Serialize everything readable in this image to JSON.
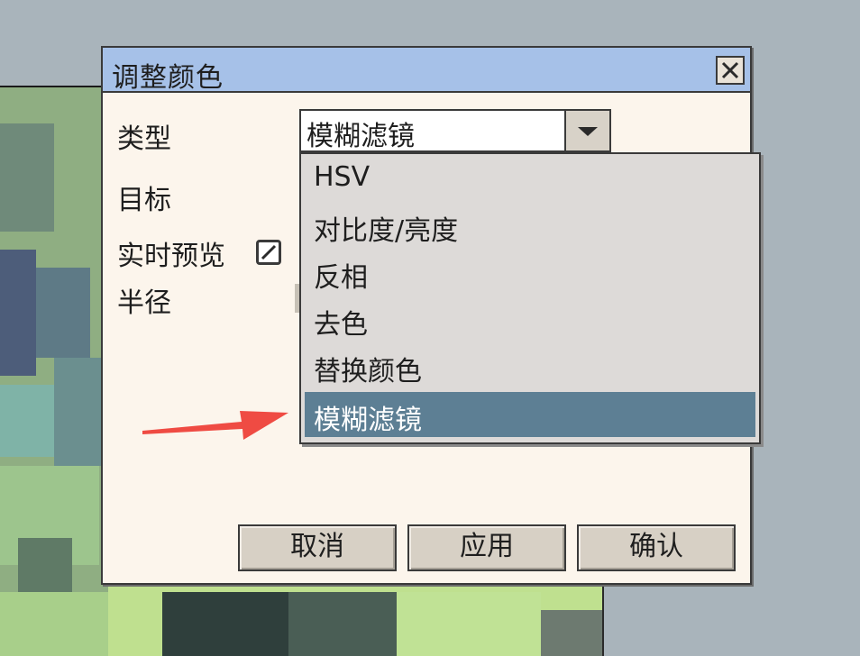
{
  "dialog": {
    "title": "调整颜色",
    "labels": {
      "type": "类型",
      "target": "目标",
      "live_preview": "实时预览",
      "radius": "半径"
    },
    "type_select": {
      "selected": "模糊滤镜",
      "options": [
        "HSV",
        "对比度/亮度",
        "反相",
        "去色",
        "替换颜色",
        "模糊滤镜"
      ],
      "selected_index": 5
    },
    "live_preview_checked": true,
    "buttons": {
      "cancel": "取消",
      "apply": "应用",
      "confirm": "确认"
    }
  },
  "icons": {
    "close": "close-icon",
    "dropdown": "triangle-down-icon",
    "checkbox": "checkmark-icon",
    "annotation": "red-arrow-icon"
  },
  "colors": {
    "titlebar": "#a6c1e8",
    "dialog_bg": "#fcf5ec",
    "selected_option": "#5d7f94",
    "annotation_arrow": "#ef4b43"
  }
}
